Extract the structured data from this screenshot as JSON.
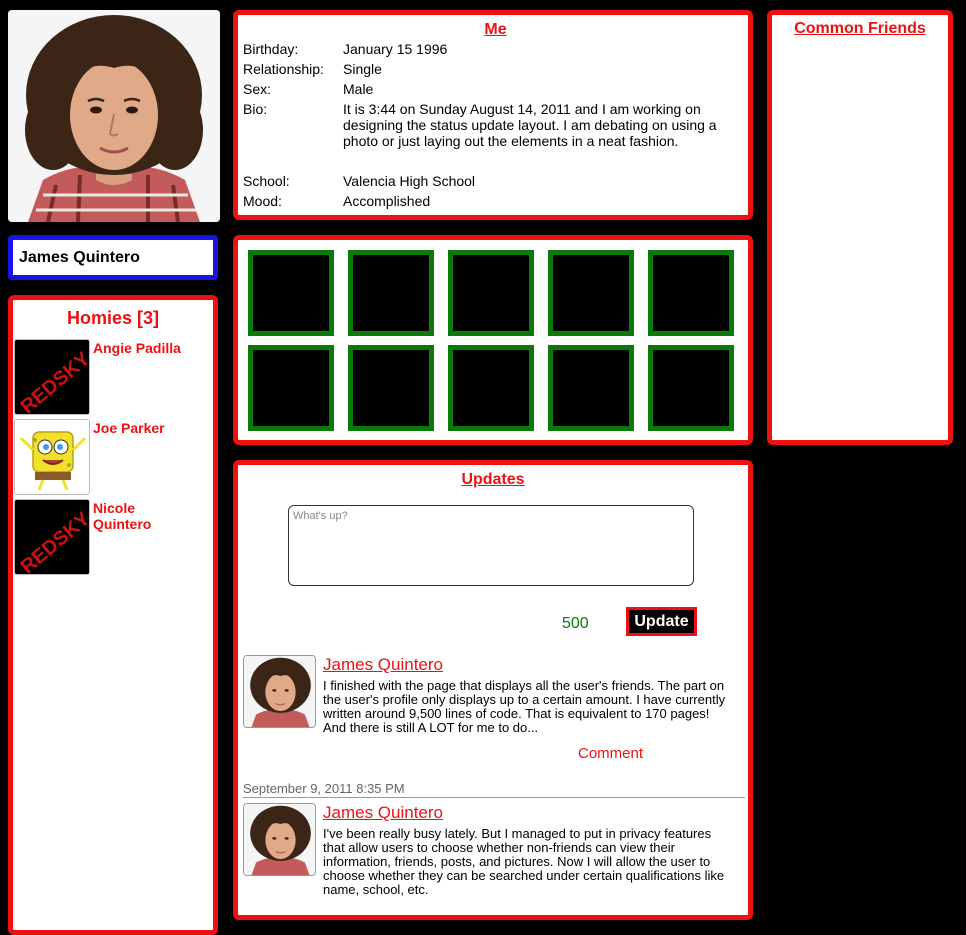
{
  "profile": {
    "name": "James Quintero"
  },
  "homies": {
    "title": "Homies [3]",
    "items": [
      {
        "name": "Angie Padilla",
        "thumb_text": "REDSKY"
      },
      {
        "name": "Joe Parker",
        "thumb_icon": "spongebob-icon"
      },
      {
        "name": "Nicole Quintero",
        "thumb_text": "REDSKY"
      }
    ]
  },
  "me": {
    "title": "Me",
    "fields": [
      {
        "label": "Birthday:",
        "value": "January 15 1996"
      },
      {
        "label": "Relationship:",
        "value": "Single"
      },
      {
        "label": "Sex:",
        "value": "Male"
      },
      {
        "label": "Bio:",
        "value": "It is 3:44 on Sunday August 14, 2011 and I am working on designing the status update layout. I am debating on using a photo or just laying out the elements in a neat fashion."
      },
      {
        "label": "School:",
        "value": "Valencia High School"
      },
      {
        "label": "Mood:",
        "value": "Accomplished"
      }
    ]
  },
  "common_friends": {
    "title": "Common Friends"
  },
  "updates": {
    "title": "Updates",
    "placeholder": "What's up?",
    "char_count": "500",
    "update_label": "Update",
    "posts": [
      {
        "author": "James Quintero",
        "text": "I finished with the page that displays all the user's friends. The part on the user's profile only displays up to a certain amount. I have currently written around 9,500 lines of code. That is equivalent to 170 pages! And there is still A LOT for me to do...",
        "comment_label": "Comment"
      },
      {
        "author": "James Quintero",
        "text": "I've been really busy lately. But I managed to put in privacy features that allow users to choose whether non-friends can view their information, friends, posts, and pictures. Now I will allow the user to choose whether they can be searched under certain qualifications like name, school, etc."
      }
    ],
    "date_separator": "September 9, 2011 8:35 PM"
  },
  "colors": {
    "accent_red": "#ee1111",
    "name_box_blue": "#1b12e6",
    "photo_frame_green": "#0a7a0a",
    "background": "#000000"
  }
}
